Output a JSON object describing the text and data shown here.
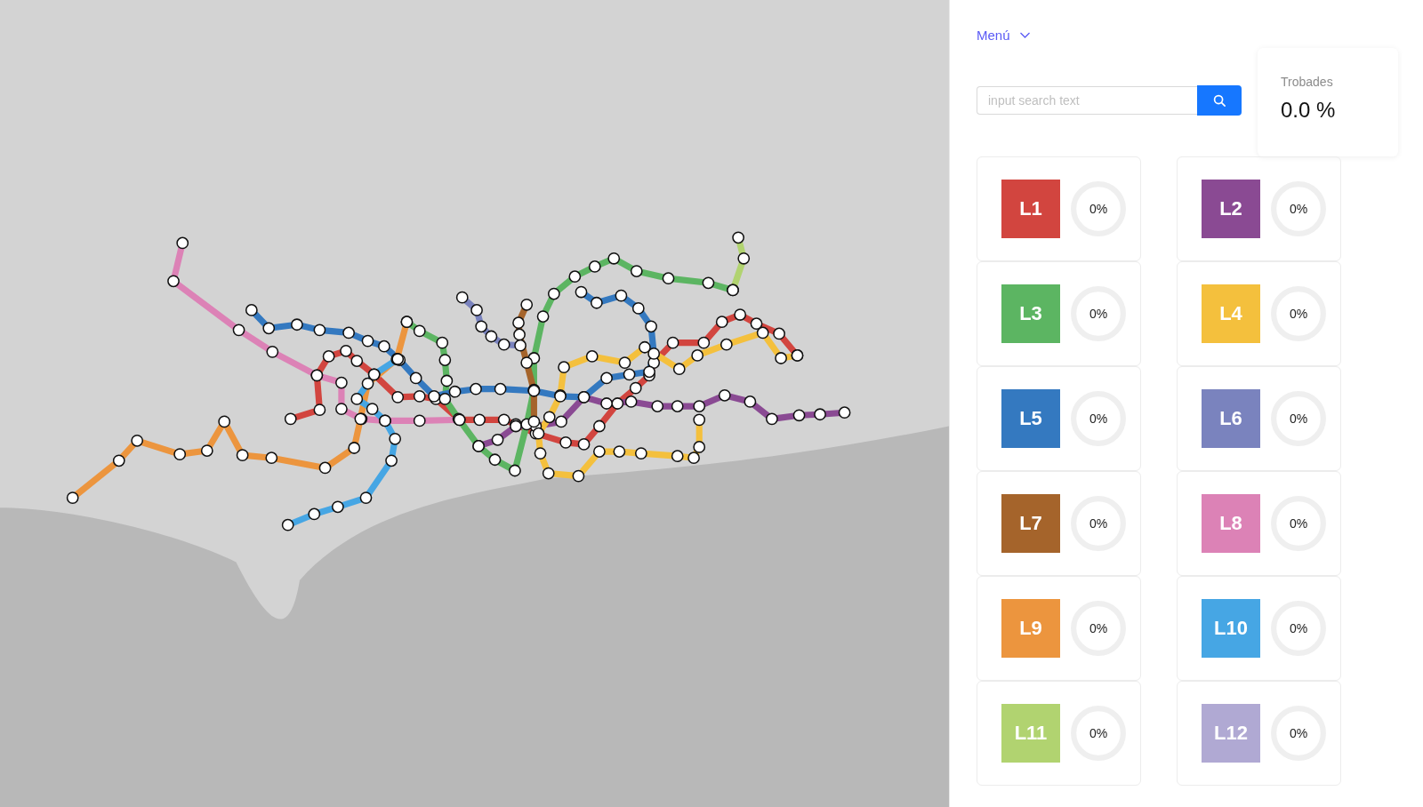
{
  "menu": {
    "label": "Menú"
  },
  "search": {
    "placeholder": "input search text"
  },
  "found": {
    "label": "Trobades",
    "value": "0.0",
    "unit": "%"
  },
  "lines": [
    {
      "label": "L1",
      "color": "#d2453f",
      "reading": "0%"
    },
    {
      "label": "L2",
      "color": "#8a4a93",
      "reading": "0%"
    },
    {
      "label": "L3",
      "color": "#5cb562",
      "reading": "0%"
    },
    {
      "label": "L4",
      "color": "#f4c03d",
      "reading": "0%"
    },
    {
      "label": "L5",
      "color": "#3479c0",
      "reading": "0%"
    },
    {
      "label": "L6",
      "color": "#7a83be",
      "reading": "0%"
    },
    {
      "label": "L7",
      "color": "#a5642b",
      "reading": "0%"
    },
    {
      "label": "L8",
      "color": "#dc82b6",
      "reading": "0%"
    },
    {
      "label": "L9",
      "color": "#ec953e",
      "reading": "0%"
    },
    {
      "label": "L10",
      "color": "#46a6e4",
      "reading": "0%"
    },
    {
      "label": "L11",
      "color": "#b1d370",
      "reading": "0%"
    },
    {
      "label": "L12",
      "color": "#b0a9d3",
      "reading": "0%"
    }
  ]
}
